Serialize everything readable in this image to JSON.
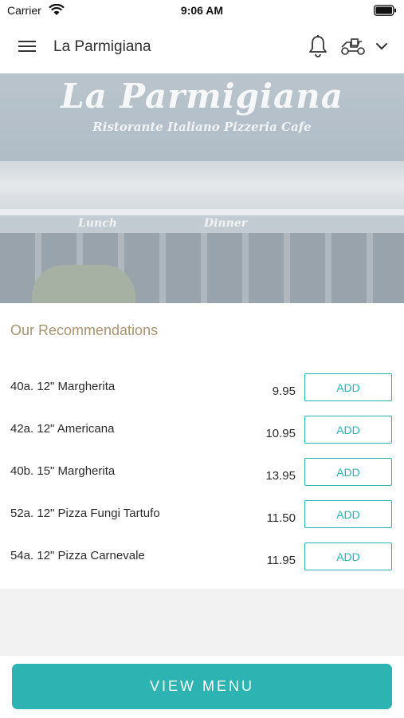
{
  "status_bar": {
    "carrier": "Carrier",
    "time": "9:06 AM",
    "icons": [
      "wifi-icon",
      "battery-icon"
    ]
  },
  "header": {
    "title": "La Parmigiana",
    "icons": [
      "hamburger-menu-icon",
      "bell-icon",
      "delivery-scooter-icon",
      "chevron-down-icon"
    ]
  },
  "hero": {
    "sign_title": "La Parmigiana",
    "sign_subtitle": "Ristorante Italiano Pizzeria Cafe",
    "band_left": "Lunch",
    "band_right": "Dinner"
  },
  "recommendations": {
    "title": "Our Recommendations",
    "items": [
      {
        "name": "40a. 12\" Margherita",
        "price": "9.95",
        "action": "ADD"
      },
      {
        "name": "42a. 12\" Americana",
        "price": "10.95",
        "action": "ADD"
      },
      {
        "name": "40b. 15\" Margherita",
        "price": "13.95",
        "action": "ADD"
      },
      {
        "name": "52a. 12\" Pizza Fungi Tartufo",
        "price": "11.50",
        "action": "ADD"
      },
      {
        "name": "54a. 12\" Pizza Carnevale",
        "price": "11.95",
        "action": "ADD"
      }
    ]
  },
  "footer": {
    "view_menu_label": "VIEW MENU"
  },
  "colors": {
    "accent": "#2db3b1",
    "section_title": "#a89472",
    "background": "#f2f2f2"
  }
}
